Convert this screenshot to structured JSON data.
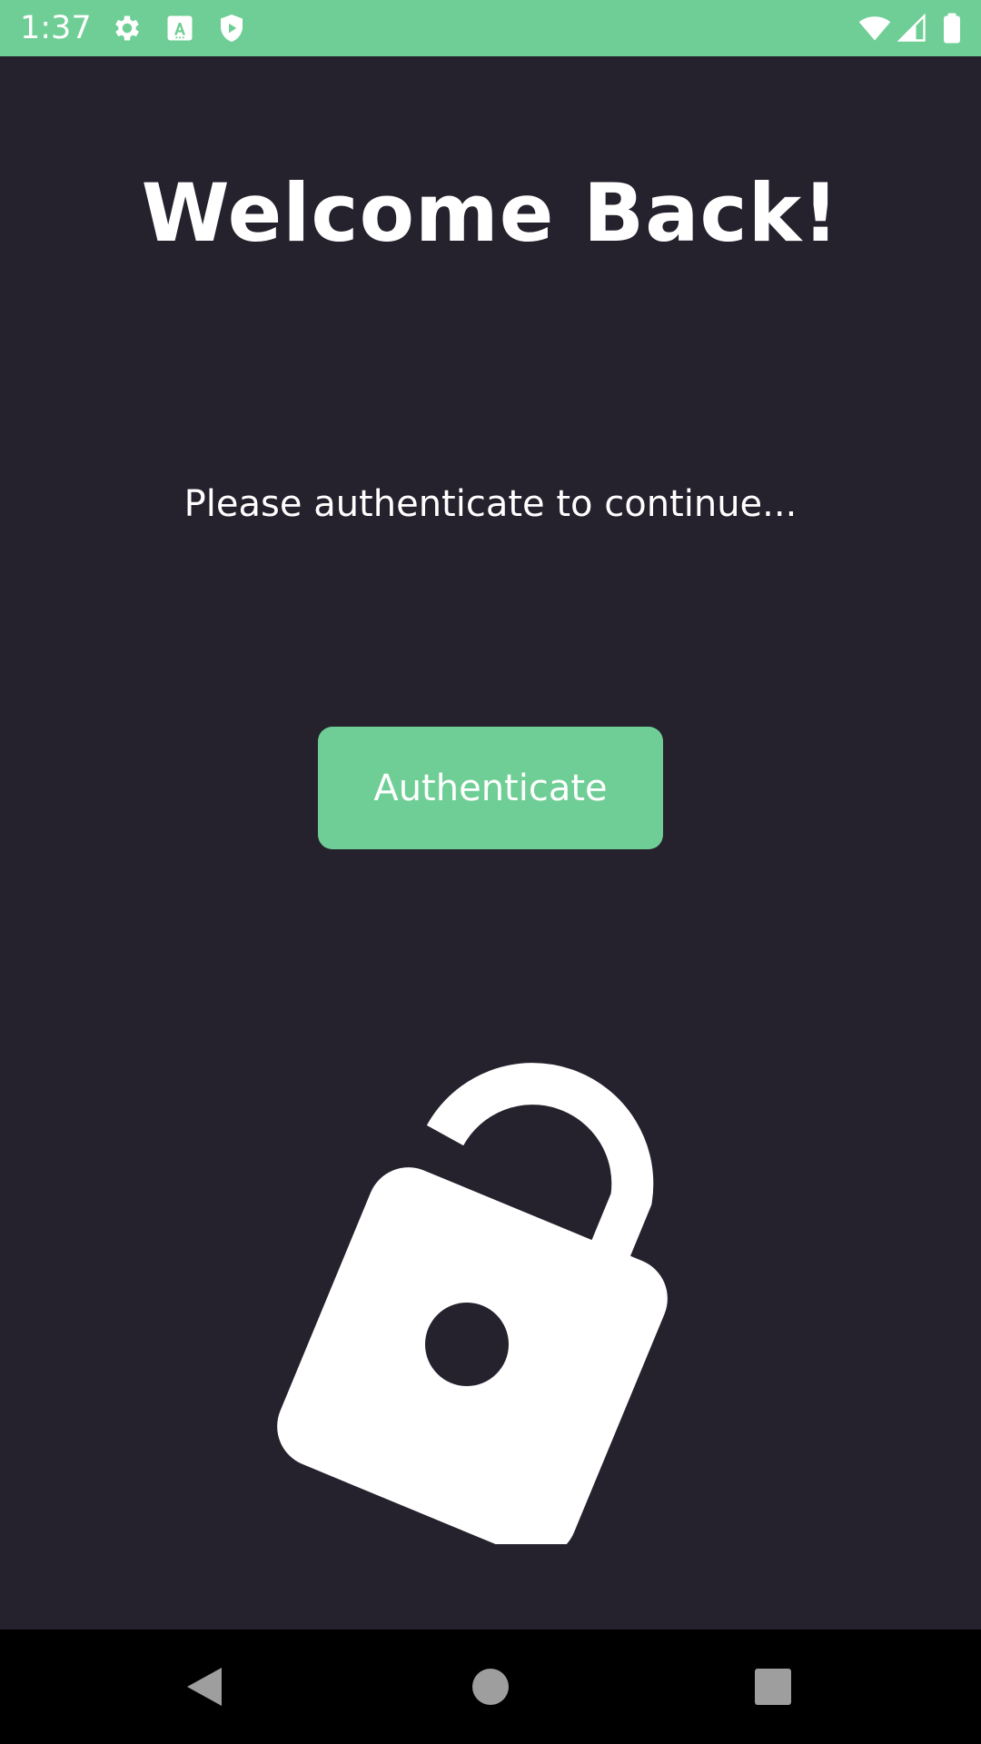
{
  "status_bar": {
    "time": "1:37",
    "background_color": "#6fce95",
    "left_icons": [
      "settings-icon",
      "font-a-icon",
      "shield-play-icon"
    ],
    "right_icons": [
      "wifi-icon",
      "cellular-signal-icon",
      "battery-icon"
    ]
  },
  "main": {
    "title": "Welcome Back!",
    "subtitle": "Please authenticate to continue...",
    "button_label": "Authenticate",
    "button_color": "#6fce95",
    "background_color": "#25212d",
    "illustration_icon": "unlocked-padlock-icon"
  },
  "nav_bar": {
    "buttons": [
      "back-triangle-icon",
      "home-circle-icon",
      "recents-square-icon"
    ]
  }
}
